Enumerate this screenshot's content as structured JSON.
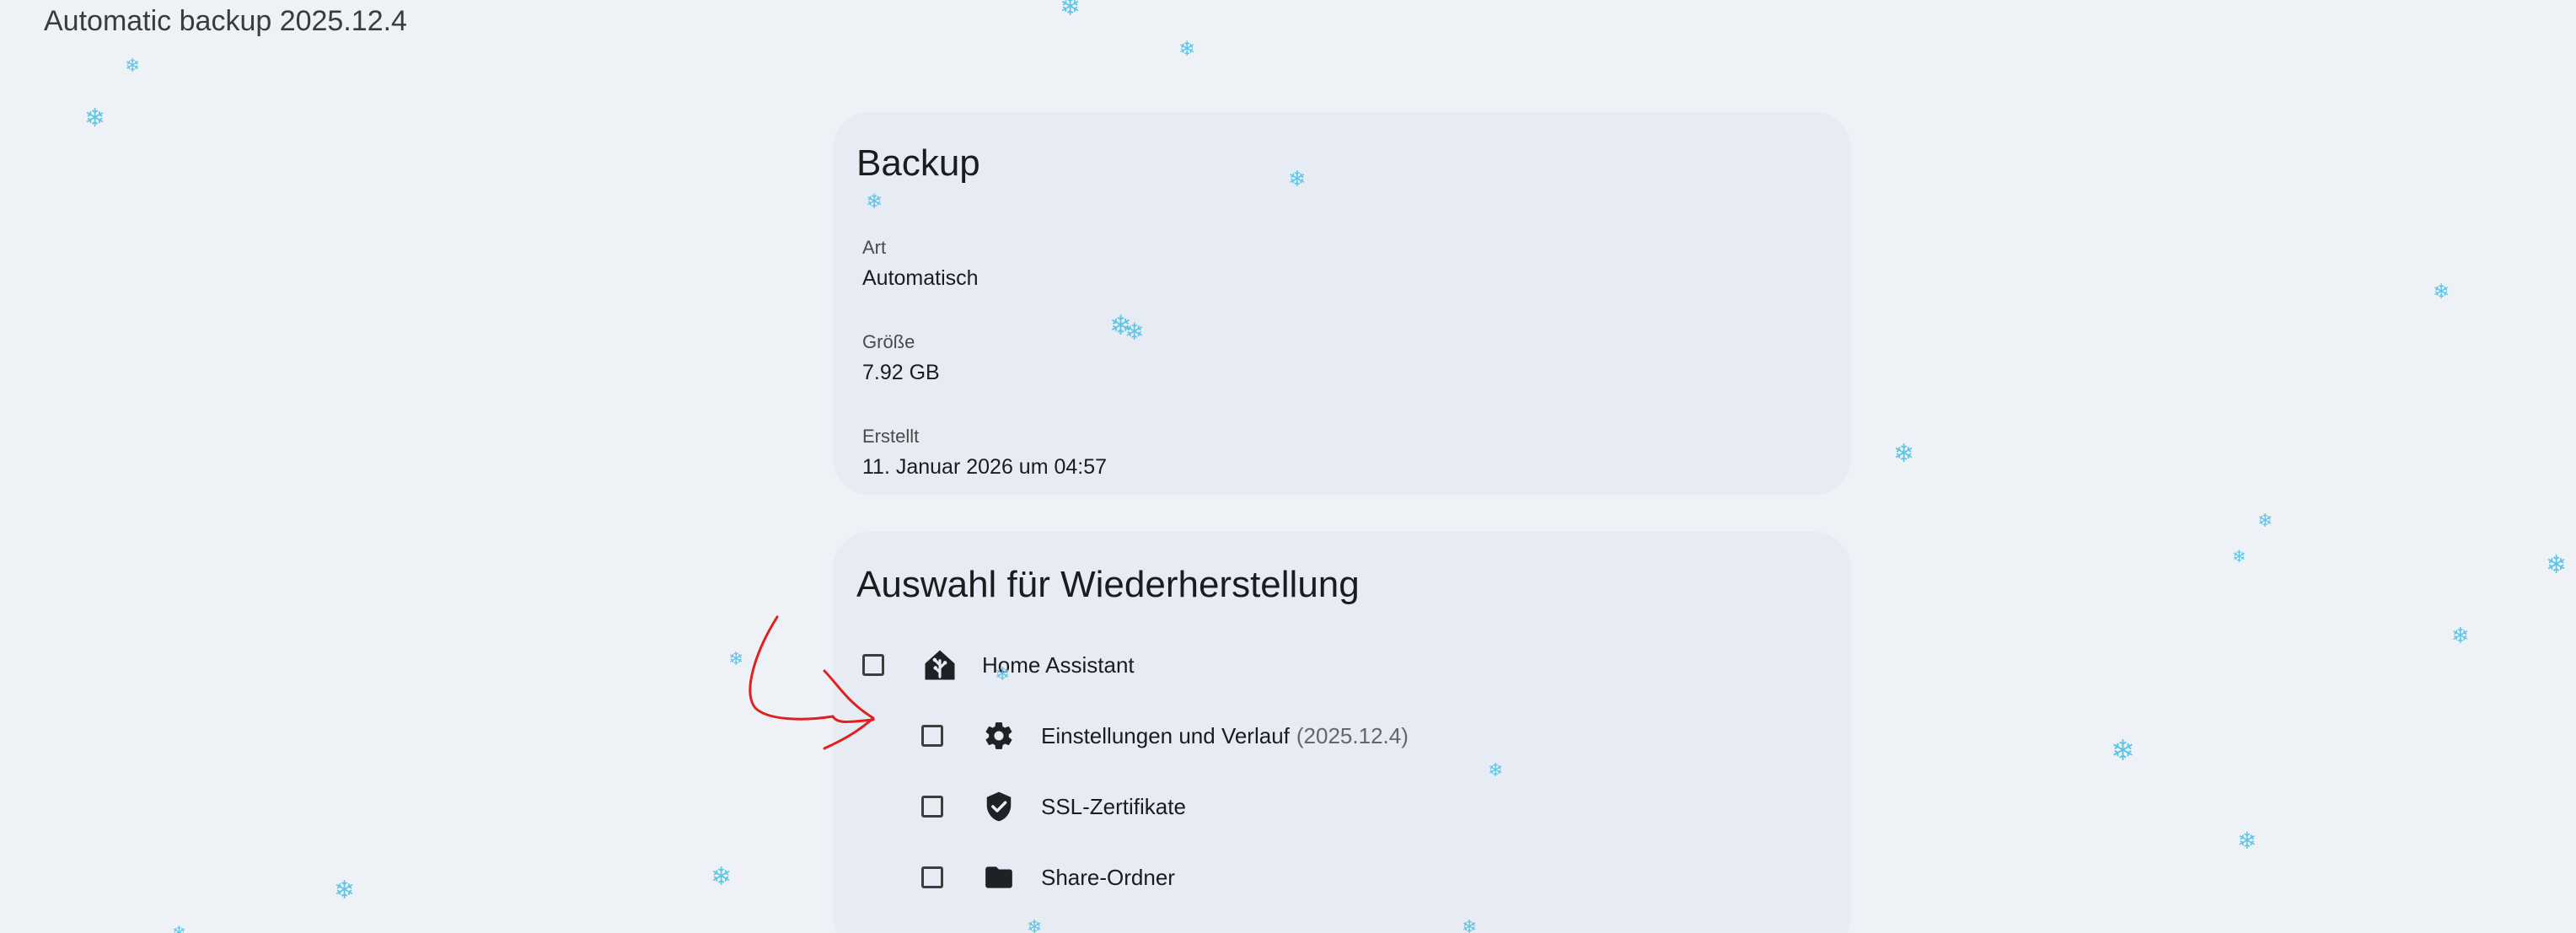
{
  "page": {
    "title": "Automatic backup 2025.12.4"
  },
  "backup_card": {
    "title": "Backup",
    "fields": [
      {
        "label": "Art",
        "value": "Automatisch"
      },
      {
        "label": "Größe",
        "value": "7.92 GB"
      },
      {
        "label": "Erstellt",
        "value": "11. Januar 2026 um 04:57"
      }
    ]
  },
  "restore_card": {
    "title": "Auswahl für Wiederherstellung",
    "items": [
      {
        "label": "Home Assistant",
        "icon": "home-assistant-icon",
        "checked": false
      },
      {
        "label": "Einstellungen und Verlauf",
        "suffix": "(2025.12.4)",
        "icon": "gear-icon",
        "checked": false
      },
      {
        "label": "SSL-Zertifikate",
        "icon": "shield-check-icon",
        "checked": false
      },
      {
        "label": "Share-Ordner",
        "icon": "folder-icon",
        "checked": false
      }
    ]
  },
  "decorations": {
    "snowflake_glyph": "❄",
    "snowflake_color": "#5ec6e4",
    "annotation_color": "#e0201f"
  }
}
